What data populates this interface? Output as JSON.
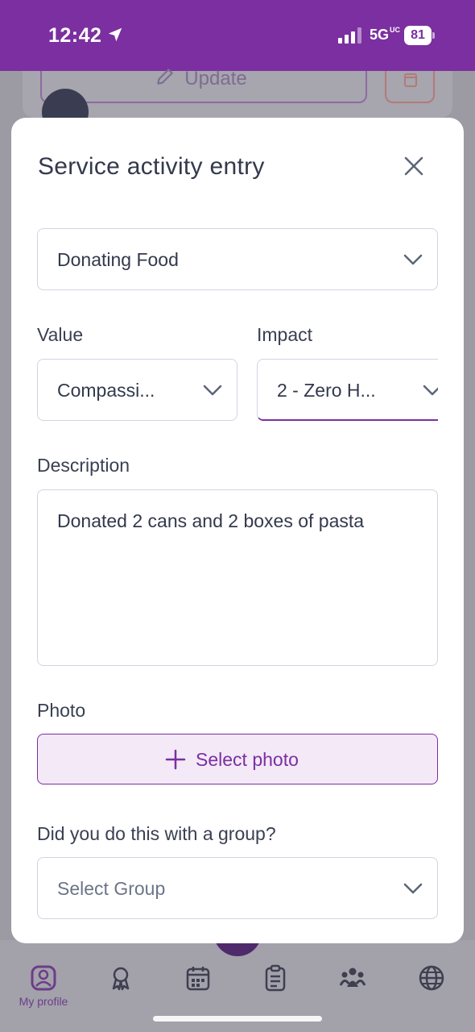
{
  "status_bar": {
    "time": "12:42",
    "network": "5G",
    "network_sup": "UC",
    "battery": "81"
  },
  "background": {
    "update_label": "Update"
  },
  "modal": {
    "title": "Service activity entry",
    "activity": {
      "selected": "Donating Food"
    },
    "value": {
      "label": "Value",
      "selected": "Compassi..."
    },
    "impact": {
      "label": "Impact",
      "selected": "2 - Zero H..."
    },
    "description": {
      "label": "Description",
      "value": "Donated 2 cans and 2 boxes of pasta"
    },
    "photo": {
      "label": "Photo",
      "button_label": "Select photo"
    },
    "group": {
      "label": "Did you do this with a group?",
      "placeholder": "Select Group"
    }
  },
  "bottom_nav": {
    "items": [
      {
        "label": "My profile",
        "icon": "profile-icon"
      },
      {
        "label": "",
        "icon": "award-icon"
      },
      {
        "label": "",
        "icon": "calendar-icon"
      },
      {
        "label": "",
        "icon": "clipboard-icon"
      },
      {
        "label": "",
        "icon": "group-icon"
      },
      {
        "label": "",
        "icon": "globe-icon"
      }
    ]
  },
  "colors": {
    "brand": "#7b2fa0",
    "photo_button_bg": "#f3e9f7",
    "border": "#cfd5e2"
  }
}
